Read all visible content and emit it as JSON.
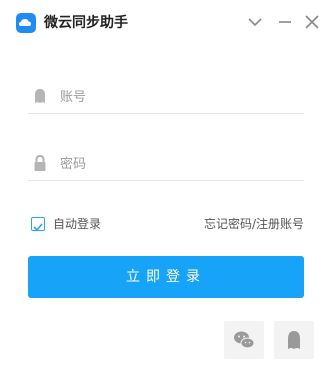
{
  "window": {
    "title": "微云同步助手",
    "controls": {
      "dropdown_icon": "chevron-down-icon",
      "minimize_icon": "minimize-icon",
      "close_icon": "close-icon"
    }
  },
  "form": {
    "account": {
      "icon": "user-icon",
      "placeholder": "账号",
      "value": ""
    },
    "password": {
      "icon": "lock-icon",
      "placeholder": "密码",
      "value": ""
    },
    "remember": {
      "label": "自动登录",
      "checked": true
    },
    "links": {
      "forgot": "忘记密码/注册账号"
    },
    "login_button": "立即登录"
  },
  "social": [
    {
      "name": "WeChat",
      "icon": "wechat-icon"
    },
    {
      "name": "QQ",
      "icon": "qq-icon"
    }
  ],
  "colors": {
    "accent": "#17a3f8",
    "logo": "#1f8cf0",
    "checkbox": "#2aa1f5"
  }
}
